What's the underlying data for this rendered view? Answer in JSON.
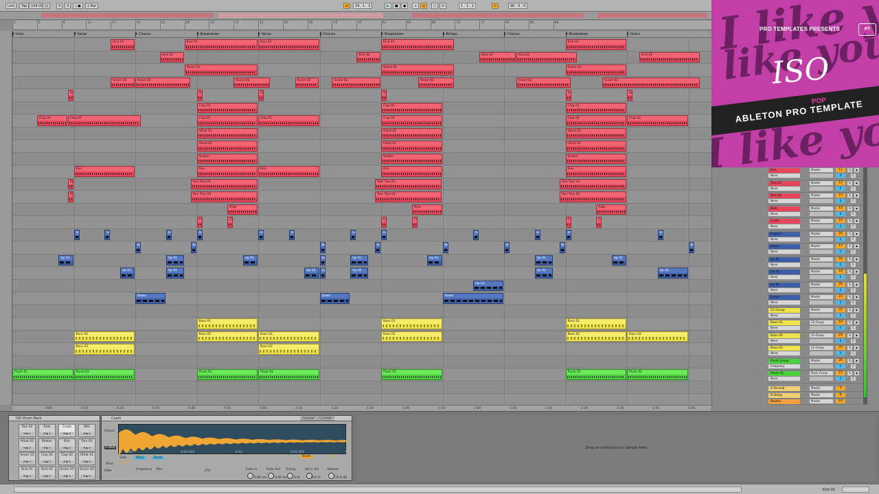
{
  "transport": {
    "link": "Link",
    "tap": "Tap",
    "tempo": "109.00",
    "sig_num": "4",
    "sig_den": "4",
    "metro": "○●",
    "quantize": "1 Bar",
    "position": "24 . 1 . 3",
    "loop_start": "1 . 1 . 1",
    "loop_len": "90 . 0 . 0"
  },
  "locators": [
    "Intro",
    "Verse",
    "Chorus",
    "Breakdown",
    "Verse",
    "Chorus",
    "Breakdown",
    "Bridge",
    "Chorus",
    "Breakdown",
    "Outro"
  ],
  "ruler_ticks": [
    "1",
    "5",
    "9",
    "13",
    "17",
    "21",
    "25",
    "29",
    "33",
    "37",
    "41",
    "45",
    "49",
    "53",
    "57",
    "61",
    "65",
    "69",
    "73",
    "77",
    "81",
    "85",
    "89"
  ],
  "time_ticks": [
    "0:00",
    "0:10",
    "0:20",
    "0:30",
    "0:40",
    "0:50",
    "1:00",
    "1:10",
    "1:20",
    "1:30",
    "1:40",
    "1:50",
    "2:00",
    "2:10",
    "2:20",
    "2:30",
    "2:40",
    "2:50",
    "3:00",
    "3:10",
    "3:20"
  ],
  "clips": [
    {
      "lane": 0,
      "bar": 16,
      "len": 4,
      "label": "Kick 01",
      "color": "red"
    },
    {
      "lane": 0,
      "bar": 28,
      "len": 12,
      "label": "Kick 01",
      "color": "red"
    },
    {
      "lane": 0,
      "bar": 40,
      "len": 10,
      "label": "Kick 01",
      "color": "red"
    },
    {
      "lane": 0,
      "bar": 60,
      "len": 12,
      "label": "Kick 01",
      "color": "red"
    },
    {
      "lane": 0,
      "bar": 90,
      "len": 10,
      "label": "Kick 01",
      "color": "red"
    },
    {
      "lane": 1,
      "bar": 24,
      "len": 4,
      "label": "Kick 02",
      "color": "red"
    },
    {
      "lane": 1,
      "bar": 56,
      "len": 4,
      "label": "Kick 02",
      "color": "red"
    },
    {
      "lane": 1,
      "bar": 76,
      "len": 6,
      "label": "Kick 02",
      "color": "red"
    },
    {
      "lane": 1,
      "bar": 82,
      "len": 10,
      "label": "Kick 02",
      "color": "red"
    },
    {
      "lane": 1,
      "bar": 102,
      "len": 10,
      "label": "Kick 02",
      "color": "red"
    },
    {
      "lane": 2,
      "bar": 28,
      "len": 12,
      "label": "Snare 01",
      "color": "red"
    },
    {
      "lane": 2,
      "bar": 60,
      "len": 12,
      "label": "Snare 01",
      "color": "red"
    },
    {
      "lane": 2,
      "bar": 90,
      "len": 10,
      "label": "Snare 01",
      "color": "red"
    },
    {
      "lane": 3,
      "bar": 16,
      "len": 4,
      "label": "Snare 02",
      "color": "red"
    },
    {
      "lane": 3,
      "bar": 20,
      "len": 9,
      "label": "Snare 02",
      "color": "red"
    },
    {
      "lane": 3,
      "bar": 36,
      "len": 6,
      "label": "Snare 02",
      "color": "red"
    },
    {
      "lane": 3,
      "bar": 46,
      "len": 4,
      "label": "Snare 02",
      "color": "red"
    },
    {
      "lane": 3,
      "bar": 52,
      "len": 8,
      "label": "Snare 02",
      "color": "red"
    },
    {
      "lane": 3,
      "bar": 66,
      "len": 6,
      "label": "Snare 02",
      "color": "red"
    },
    {
      "lane": 3,
      "bar": 82,
      "len": 9,
      "label": "Snare 02",
      "color": "red"
    },
    {
      "lane": 3,
      "bar": 96,
      "len": 16,
      "label": "Snare 02",
      "color": "red"
    },
    {
      "lane": 4,
      "bar": 9,
      "len": 1,
      "label": "Sna",
      "color": "red"
    },
    {
      "lane": 4,
      "bar": 30,
      "len": 1,
      "label": "Sna",
      "color": "red"
    },
    {
      "lane": 4,
      "bar": 40,
      "len": 1,
      "label": "Sna",
      "color": "red"
    },
    {
      "lane": 4,
      "bar": 60,
      "len": 1,
      "label": "Sna",
      "color": "red"
    },
    {
      "lane": 4,
      "bar": 90,
      "len": 1,
      "label": "Sna",
      "color": "red"
    },
    {
      "lane": 4,
      "bar": 100,
      "len": 1,
      "label": "Sna",
      "color": "red"
    },
    {
      "lane": 5,
      "bar": 30,
      "len": 10,
      "label": "Clap 01",
      "color": "red"
    },
    {
      "lane": 5,
      "bar": 60,
      "len": 10,
      "label": "Clap 01",
      "color": "red"
    },
    {
      "lane": 5,
      "bar": 90,
      "len": 10,
      "label": "Clap 01",
      "color": "red"
    },
    {
      "lane": 6,
      "bar": 4,
      "len": 5,
      "label": "Clap 02",
      "color": "red"
    },
    {
      "lane": 6,
      "bar": 9,
      "len": 12,
      "label": "Clap 02",
      "color": "red"
    },
    {
      "lane": 6,
      "bar": 30,
      "len": 10,
      "label": "Clap 02",
      "color": "red"
    },
    {
      "lane": 6,
      "bar": 40,
      "len": 10,
      "label": "Clap 02",
      "color": "red"
    },
    {
      "lane": 6,
      "bar": 60,
      "len": 10,
      "label": "Clap 02",
      "color": "red"
    },
    {
      "lane": 6,
      "bar": 90,
      "len": 10,
      "label": "Clap 02",
      "color": "red"
    },
    {
      "lane": 6,
      "bar": 100,
      "len": 10,
      "label": "Clap 02",
      "color": "red"
    },
    {
      "lane": 7,
      "bar": 30,
      "len": 10,
      "label": "Hihat 01",
      "color": "red"
    },
    {
      "lane": 7,
      "bar": 60,
      "len": 10,
      "label": "Hihat 01",
      "color": "red"
    },
    {
      "lane": 7,
      "bar": 90,
      "len": 10,
      "label": "Hihat 01",
      "color": "red"
    },
    {
      "lane": 8,
      "bar": 30,
      "len": 10,
      "label": "Hihat 02",
      "color": "red"
    },
    {
      "lane": 8,
      "bar": 60,
      "len": 10,
      "label": "Hihat 02",
      "color": "red"
    },
    {
      "lane": 8,
      "bar": 90,
      "len": 10,
      "label": "Hihat 02",
      "color": "red"
    },
    {
      "lane": 9,
      "bar": 30,
      "len": 10,
      "label": "Shaker",
      "color": "red"
    },
    {
      "lane": 9,
      "bar": 60,
      "len": 10,
      "label": "Shaker",
      "color": "red"
    },
    {
      "lane": 9,
      "bar": 90,
      "len": 10,
      "label": "Shaker",
      "color": "red"
    },
    {
      "lane": 10,
      "bar": 10,
      "len": 10,
      "label": "Rim",
      "color": "red"
    },
    {
      "lane": 10,
      "bar": 30,
      "len": 10,
      "label": "Rim",
      "color": "red"
    },
    {
      "lane": 10,
      "bar": 40,
      "len": 10,
      "label": "Rim",
      "color": "red"
    },
    {
      "lane": 10,
      "bar": 60,
      "len": 10,
      "label": "Rim",
      "color": "red"
    },
    {
      "lane": 10,
      "bar": 90,
      "len": 10,
      "label": "Rim",
      "color": "red"
    },
    {
      "lane": 11,
      "bar": 9,
      "len": 1,
      "label": "Tom",
      "color": "red"
    },
    {
      "lane": 11,
      "bar": 29,
      "len": 11,
      "label": "Tom Tom 01",
      "color": "red"
    },
    {
      "lane": 11,
      "bar": 59,
      "len": 11,
      "label": "Tom Tom 01",
      "color": "red"
    },
    {
      "lane": 11,
      "bar": 89,
      "len": 11,
      "label": "Tom Tom 01",
      "color": "red"
    },
    {
      "lane": 12,
      "bar": 9,
      "len": 1,
      "label": "Tom",
      "color": "red"
    },
    {
      "lane": 12,
      "bar": 29,
      "len": 11,
      "label": "Tom Tom 02",
      "color": "red"
    },
    {
      "lane": 12,
      "bar": 59,
      "len": 11,
      "label": "Tom Tom 02",
      "color": "red"
    },
    {
      "lane": 12,
      "bar": 89,
      "len": 11,
      "label": "Tom Tom 02",
      "color": "red"
    },
    {
      "lane": 13,
      "bar": 35,
      "len": 5,
      "label": "Ride",
      "color": "red"
    },
    {
      "lane": 13,
      "bar": 65,
      "len": 5,
      "label": "Ride",
      "color": "red"
    },
    {
      "lane": 13,
      "bar": 95,
      "len": 5,
      "label": "Ride",
      "color": "red"
    },
    {
      "lane": 14,
      "bar": 30,
      "len": 1,
      "label": "Cra",
      "color": "red"
    },
    {
      "lane": 14,
      "bar": 35,
      "len": 1,
      "label": "Cra",
      "color": "red"
    },
    {
      "lane": 14,
      "bar": 60,
      "len": 1,
      "label": "Cra",
      "color": "red"
    },
    {
      "lane": 14,
      "bar": 65,
      "len": 1,
      "label": "Cra",
      "color": "red"
    },
    {
      "lane": 14,
      "bar": 90,
      "len": 1,
      "label": "Cra",
      "color": "red"
    },
    {
      "lane": 14,
      "bar": 95,
      "len": 1,
      "label": "Cra",
      "color": "red"
    },
    {
      "lane": 15,
      "bar": 10,
      "len": 1,
      "label": "Imp",
      "color": "blue"
    },
    {
      "lane": 15,
      "bar": 15,
      "len": 1,
      "label": "Imp",
      "color": "blue"
    },
    {
      "lane": 15,
      "bar": 25,
      "len": 1,
      "label": "Imp",
      "color": "blue"
    },
    {
      "lane": 15,
      "bar": 30,
      "len": 1,
      "label": "Imp",
      "color": "blue"
    },
    {
      "lane": 15,
      "bar": 40,
      "len": 1,
      "label": "Imp",
      "color": "blue"
    },
    {
      "lane": 15,
      "bar": 45,
      "len": 1,
      "label": "Imp",
      "color": "blue"
    },
    {
      "lane": 15,
      "bar": 55,
      "len": 1,
      "label": "Imp",
      "color": "blue"
    },
    {
      "lane": 15,
      "bar": 60,
      "len": 1,
      "label": "Imp",
      "color": "blue"
    },
    {
      "lane": 15,
      "bar": 75,
      "len": 1,
      "label": "Imp",
      "color": "blue"
    },
    {
      "lane": 15,
      "bar": 85,
      "len": 1,
      "label": "Imp",
      "color": "blue"
    },
    {
      "lane": 15,
      "bar": 90,
      "len": 1,
      "label": "Imp",
      "color": "blue"
    },
    {
      "lane": 15,
      "bar": 105,
      "len": 1,
      "label": "Imp",
      "color": "blue"
    },
    {
      "lane": 16,
      "bar": 20,
      "len": 1,
      "label": "Boo",
      "color": "blue"
    },
    {
      "lane": 16,
      "bar": 29,
      "len": 1,
      "label": "Boo",
      "color": "blue"
    },
    {
      "lane": 16,
      "bar": 50,
      "len": 1,
      "label": "Boo",
      "color": "blue"
    },
    {
      "lane": 16,
      "bar": 59,
      "len": 1,
      "label": "Boo",
      "color": "blue"
    },
    {
      "lane": 16,
      "bar": 70,
      "len": 1,
      "label": "Boo",
      "color": "blue"
    },
    {
      "lane": 16,
      "bar": 80,
      "len": 1,
      "label": "Boo",
      "color": "blue"
    },
    {
      "lane": 16,
      "bar": 89,
      "len": 1,
      "label": "Boo",
      "color": "blue"
    },
    {
      "lane": 16,
      "bar": 110,
      "len": 1,
      "label": "Boo",
      "color": "blue"
    },
    {
      "lane": 17,
      "bar": 7.5,
      "len": 2.5,
      "label": "Up 01",
      "color": "blue"
    },
    {
      "lane": 17,
      "bar": 25,
      "len": 3,
      "label": "Up 01",
      "color": "blue"
    },
    {
      "lane": 17,
      "bar": 37.5,
      "len": 2.5,
      "label": "Up 01",
      "color": "blue"
    },
    {
      "lane": 17,
      "bar": 50,
      "len": 1,
      "label": "Up 0",
      "color": "blue"
    },
    {
      "lane": 17,
      "bar": 55,
      "len": 3,
      "label": "Up 01",
      "color": "blue"
    },
    {
      "lane": 17,
      "bar": 67.5,
      "len": 2.5,
      "label": "Up 01",
      "color": "blue"
    },
    {
      "lane": 17,
      "bar": 85,
      "len": 3,
      "label": "Up 01",
      "color": "blue"
    },
    {
      "lane": 17,
      "bar": 97.5,
      "len": 2.5,
      "label": "Up 01",
      "color": "blue"
    },
    {
      "lane": 18,
      "bar": 17.5,
      "len": 2.5,
      "label": "Up 02",
      "color": "blue"
    },
    {
      "lane": 18,
      "bar": 25,
      "len": 3,
      "label": "Up 02",
      "color": "blue"
    },
    {
      "lane": 18,
      "bar": 47.5,
      "len": 2.5,
      "label": "Up 02",
      "color": "blue"
    },
    {
      "lane": 18,
      "bar": 50,
      "len": 1,
      "label": "Up 0",
      "color": "blue"
    },
    {
      "lane": 18,
      "bar": 55,
      "len": 3,
      "label": "Up 02",
      "color": "blue"
    },
    {
      "lane": 18,
      "bar": 85,
      "len": 3,
      "label": "Up 02",
      "color": "blue"
    },
    {
      "lane": 18,
      "bar": 105,
      "len": 5,
      "label": "Up 02",
      "color": "blue"
    },
    {
      "lane": 19,
      "bar": 75,
      "len": 5,
      "label": "Up 03",
      "color": "blue"
    },
    {
      "lane": 20,
      "bar": 20,
      "len": 5,
      "label": "Down",
      "color": "blue"
    },
    {
      "lane": 20,
      "bar": 50,
      "len": 5,
      "label": "Down",
      "color": "blue"
    },
    {
      "lane": 20,
      "bar": 70,
      "len": 10,
      "label": "Down",
      "color": "blue"
    },
    {
      "lane": 22,
      "bar": 30,
      "len": 10,
      "label": "Bass 01",
      "color": "yellow"
    },
    {
      "lane": 22,
      "bar": 60,
      "len": 10,
      "label": "Bass 01",
      "color": "yellow"
    },
    {
      "lane": 22,
      "bar": 90,
      "len": 10,
      "label": "Bass 01",
      "color": "yellow"
    },
    {
      "lane": 23,
      "bar": 10,
      "len": 10,
      "label": "Bass 02",
      "color": "yellow"
    },
    {
      "lane": 23,
      "bar": 30,
      "len": 10,
      "label": "Bass 02",
      "color": "yellow"
    },
    {
      "lane": 23,
      "bar": 40,
      "len": 10,
      "label": "Bass 02",
      "color": "yellow"
    },
    {
      "lane": 23,
      "bar": 60,
      "len": 10,
      "label": "Bass 02",
      "color": "yellow"
    },
    {
      "lane": 23,
      "bar": 90,
      "len": 10,
      "label": "Bass 02",
      "color": "yellow"
    },
    {
      "lane": 23,
      "bar": 100,
      "len": 10,
      "label": "Bass 02",
      "color": "yellow"
    },
    {
      "lane": 24,
      "bar": 10,
      "len": 10,
      "label": "Bass 03",
      "color": "yellow"
    },
    {
      "lane": 24,
      "bar": 40,
      "len": 10,
      "label": "Bass 03",
      "color": "yellow"
    },
    {
      "lane": 26,
      "bar": 0,
      "len": 10,
      "label": "Pluck 01",
      "color": "green"
    },
    {
      "lane": 26,
      "bar": 10,
      "len": 10,
      "label": "Pluck 01",
      "color": "green"
    },
    {
      "lane": 26,
      "bar": 30,
      "len": 10,
      "label": "Pluck 01",
      "color": "green"
    },
    {
      "lane": 26,
      "bar": 40,
      "len": 10,
      "label": "Pluck 01",
      "color": "green"
    },
    {
      "lane": 26,
      "bar": 60,
      "len": 10,
      "label": "Pluck 01",
      "color": "green"
    },
    {
      "lane": 26,
      "bar": 90,
      "len": 10,
      "label": "Pluck 01",
      "color": "green"
    },
    {
      "lane": 26,
      "bar": 100,
      "len": 10,
      "label": "Pluck 01",
      "color": "green"
    }
  ],
  "mixer": [
    {
      "name": "Rim",
      "sub": "None",
      "out": "Master",
      "num": "11",
      "color": "#e8465a"
    },
    {
      "name": "Tom 01",
      "sub": "None",
      "out": "Master",
      "num": "12",
      "color": "#e8465a"
    },
    {
      "name": "Tom 02",
      "sub": "None",
      "out": "Master",
      "num": "13",
      "color": "#e8465a"
    },
    {
      "name": "Ride",
      "sub": "None",
      "out": "Master",
      "num": "14",
      "color": "#e8465a"
    },
    {
      "name": "Crash",
      "sub": "None",
      "out": "Master",
      "num": "15",
      "color": "#e8465a"
    },
    {
      "name": "Impact",
      "sub": "None",
      "out": "Master",
      "num": "16",
      "color": "#3c5fa8"
    },
    {
      "name": "Boom",
      "sub": "None",
      "out": "Master",
      "num": "17",
      "color": "#3c5fa8"
    },
    {
      "name": "Up 01",
      "sub": "None",
      "out": "Master",
      "num": "18",
      "color": "#3c5fa8"
    },
    {
      "name": "Up 02",
      "sub": "None",
      "out": "Master",
      "num": "19",
      "color": "#3c5fa8"
    },
    {
      "name": "Up 03",
      "sub": "None",
      "out": "Master",
      "num": "20",
      "color": "#3c5fa8"
    },
    {
      "name": "Down",
      "sub": "None",
      "out": "Master",
      "num": "21",
      "color": "#3c5fa8"
    },
    {
      "name": "22 Group",
      "sub": "None",
      "out": "Master",
      "num": "22",
      "color": "#f0e24a"
    },
    {
      "name": "Bass 01",
      "sub": "None",
      "out": "22-Group",
      "num": "23",
      "color": "#f0e24a"
    },
    {
      "name": "Bass 02",
      "sub": "None",
      "out": "22-Group",
      "num": "24",
      "color": "#f0e24a"
    },
    {
      "name": "Bass 03",
      "sub": "None",
      "out": "22-Group",
      "num": "25",
      "color": "#f0e24a"
    },
    {
      "name": "Pluck Group",
      "sub": "Frequency",
      "out": "Master",
      "num": "26",
      "color": "#4ad23a"
    },
    {
      "name": "Pluck 01",
      "sub": "None",
      "out": "Pluck Group",
      "num": "27",
      "color": "#4ad23a"
    }
  ],
  "returns": [
    {
      "name": "A Reverb",
      "num": "A",
      "color": "#f0d070"
    },
    {
      "name": "B Delay",
      "num": "B",
      "color": "#f0d070"
    },
    {
      "name": "Master",
      "num": "1/2",
      "color": "#f0a040"
    }
  ],
  "promo": {
    "header": "PRO TEMPLATES PRESENTS",
    "title": "ISO",
    "genre": "POP",
    "subtitle": "ABLETON PRO TEMPLATE",
    "bg_text": "I like you"
  },
  "drum_rack": {
    "title": "ISO Drum Rack",
    "pads": [
      [
        "Tom 02",
        "Ride",
        "Crash",
        "DR2"
      ],
      [
        "Hihat 02",
        "Shaker",
        "Rim",
        "Tom 01"
      ],
      [
        "Snare 03",
        "Clap 01",
        "Clap 02",
        "Hihat 01"
      ],
      [
        "Kick 01",
        "Kick 02",
        "Snare 01",
        "Snare 02"
      ]
    ],
    "ms": "M ▶ S"
  },
  "simpler": {
    "title": "Crash",
    "tab_sample": "Sample",
    "tab_controls": "Controls",
    "classic": "Classic",
    "one_shot": "1-Shot",
    "slice": "Slice",
    "gain_label": "Gain",
    "gain": "0.0 dB",
    "warp": "Warp",
    "filter": "Filter",
    "frequency": "Frequency",
    "res": "Res",
    "lfo": "LFO",
    "fade_in": "Fade In",
    "fade_in_val": "0.00 ms",
    "fade_out": "Fade Out",
    "fade_out_val": "0.00 ms",
    "transp": "Transp",
    "transp_val": "0 st",
    "vol_vel": "Vol < Vel",
    "vol_vel_val": "0.0 %",
    "volume": "Volume",
    "volume_val": "-12.0 dB",
    "bar": "1 Bar",
    "beats": "Beats",
    "wave_times": [
      "0:00",
      "0:00:000",
      "0:01",
      "0:01:000",
      "0:02"
    ]
  },
  "drop_hint": "Drop an Instrument or Sample Here",
  "status": {
    "track": "Kick 01"
  }
}
